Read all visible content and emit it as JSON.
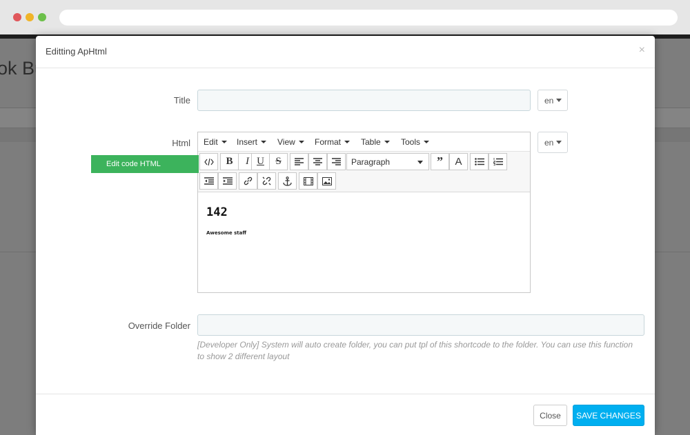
{
  "background_page": {
    "title_fragment": "ok Bu"
  },
  "modal": {
    "title": "Editting ApHtml",
    "close_symbol": "×"
  },
  "form": {
    "title_label": "Title",
    "title_value": "",
    "title_lang": "en",
    "html_label": "Html",
    "html_lang": "en",
    "edit_code_button": "Edit code HTML",
    "override_folder_label": "Override Folder",
    "override_folder_value": "",
    "override_help": "[Developer Only] System will auto create folder, you can put tpl of this shortcode to the folder. You can use this function to show 2 different layout"
  },
  "editor": {
    "menus": [
      "Edit",
      "Insert",
      "View",
      "Format",
      "Table",
      "Tools"
    ],
    "block_format": "Paragraph",
    "toolbar_icons": [
      "code-icon",
      "bold-icon",
      "italic-icon",
      "underline-icon",
      "strikethrough-icon",
      "align-left-icon",
      "align-center-icon",
      "align-right-icon",
      "blockquote-icon",
      "text-color-icon",
      "bullet-list-icon",
      "numbered-list-icon",
      "outdent-icon",
      "indent-icon",
      "link-icon",
      "unlink-icon",
      "anchor-icon",
      "media-icon",
      "image-icon"
    ],
    "content_heading": "142",
    "content_text": "Awesome staff"
  },
  "footer": {
    "close_label": "Close",
    "save_label": "SAVE CHANGES"
  },
  "colors": {
    "accent_save": "#00aff0",
    "edit_code_green": "#3cb35c"
  }
}
